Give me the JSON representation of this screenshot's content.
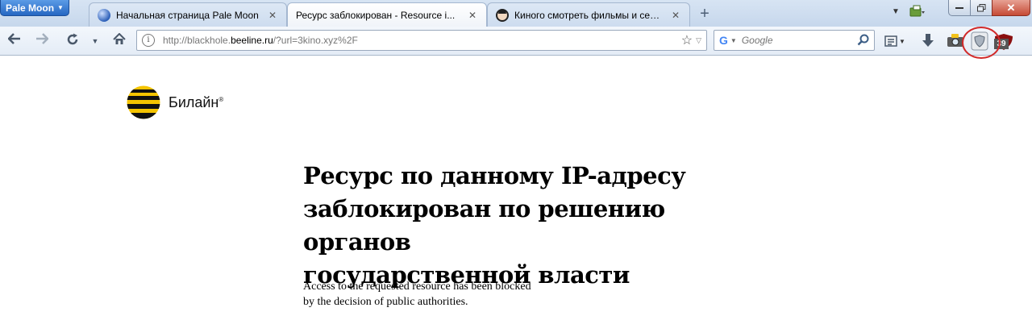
{
  "browser": {
    "app_button_label": "Pale Moon",
    "tabs": [
      {
        "title": "Начальная страница Pale Moon",
        "icon": "globe-icon",
        "active": false
      },
      {
        "title": "Ресурс заблокирован - Resource i...",
        "icon": "none",
        "active": true
      },
      {
        "title": "Киного смотреть фильмы и сери...",
        "icon": "cover-icon",
        "active": false
      }
    ],
    "new_tab_label": "+",
    "close_tab_glyph": "✕"
  },
  "navbar": {
    "url_prefix": "http://blackhole.",
    "url_domain": "beeline.ru",
    "url_suffix": "/?url=3kino.xyz%2F",
    "search_placeholder": "Google",
    "search_engine_glyph": "G",
    "ublock_badge": "39"
  },
  "page": {
    "brand": "Билайн",
    "brand_mark": "®",
    "headline_lines": [
      "Ресурс по данному IP-адресу",
      "заблокирован по решению органов",
      "государственной власти"
    ],
    "subtext_lines": [
      "Access to the requested resource has been blocked",
      "by the decision of public authorities."
    ]
  },
  "colors": {
    "beeline_yellow": "#f5c400",
    "beeline_black": "#111111",
    "highlight_red": "#d12a2a"
  }
}
